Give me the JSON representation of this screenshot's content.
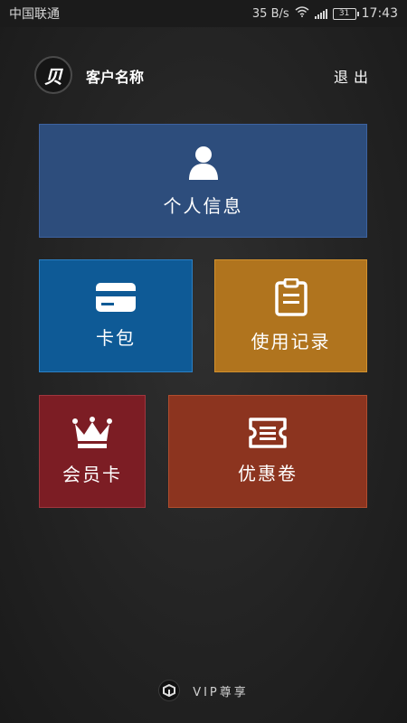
{
  "status_bar": {
    "carrier": "中国联通",
    "net_speed": "35 B/s",
    "battery": "31",
    "time": "17:43"
  },
  "header": {
    "logo_glyph": "贝",
    "customer_name": "客户名称",
    "logout_label": "退出"
  },
  "tiles": {
    "personal_info": {
      "label": "个人信息",
      "icon": "user-icon",
      "color": "#2d4d7c"
    },
    "wallet": {
      "label": "卡包",
      "icon": "card-icon",
      "color": "#0e5a96"
    },
    "usage_records": {
      "label": "使用记录",
      "icon": "clipboard-icon",
      "color": "#b0741e"
    },
    "member_card": {
      "label": "会员卡",
      "icon": "crown-icon",
      "color": "#7c1d24"
    },
    "coupons": {
      "label": "优惠卷",
      "icon": "ticket-icon",
      "color": "#8c341f"
    }
  },
  "footer": {
    "brand_text": "VIP尊享"
  }
}
